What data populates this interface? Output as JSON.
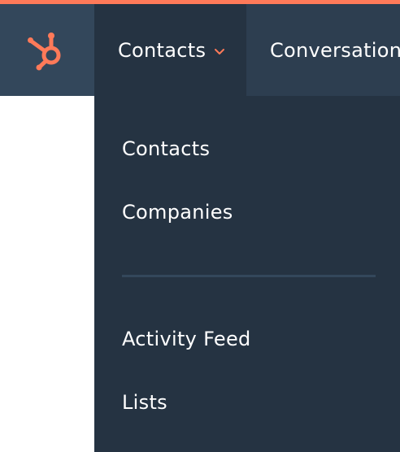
{
  "colors": {
    "accent": "#ff7a59",
    "navbar_bg": "#33475b",
    "active_bg": "#253342",
    "text": "#ffffff"
  },
  "logo": {
    "icon": "hubspot-sprocket-icon"
  },
  "nav": {
    "contacts_label": "Contacts",
    "contacts_caret_icon": "chevron-down-icon",
    "conversations_label": "Conversations"
  },
  "dropdown": {
    "items": [
      {
        "label": "Contacts"
      },
      {
        "label": "Companies"
      },
      {
        "label": "Activity Feed"
      },
      {
        "label": "Lists"
      }
    ]
  }
}
